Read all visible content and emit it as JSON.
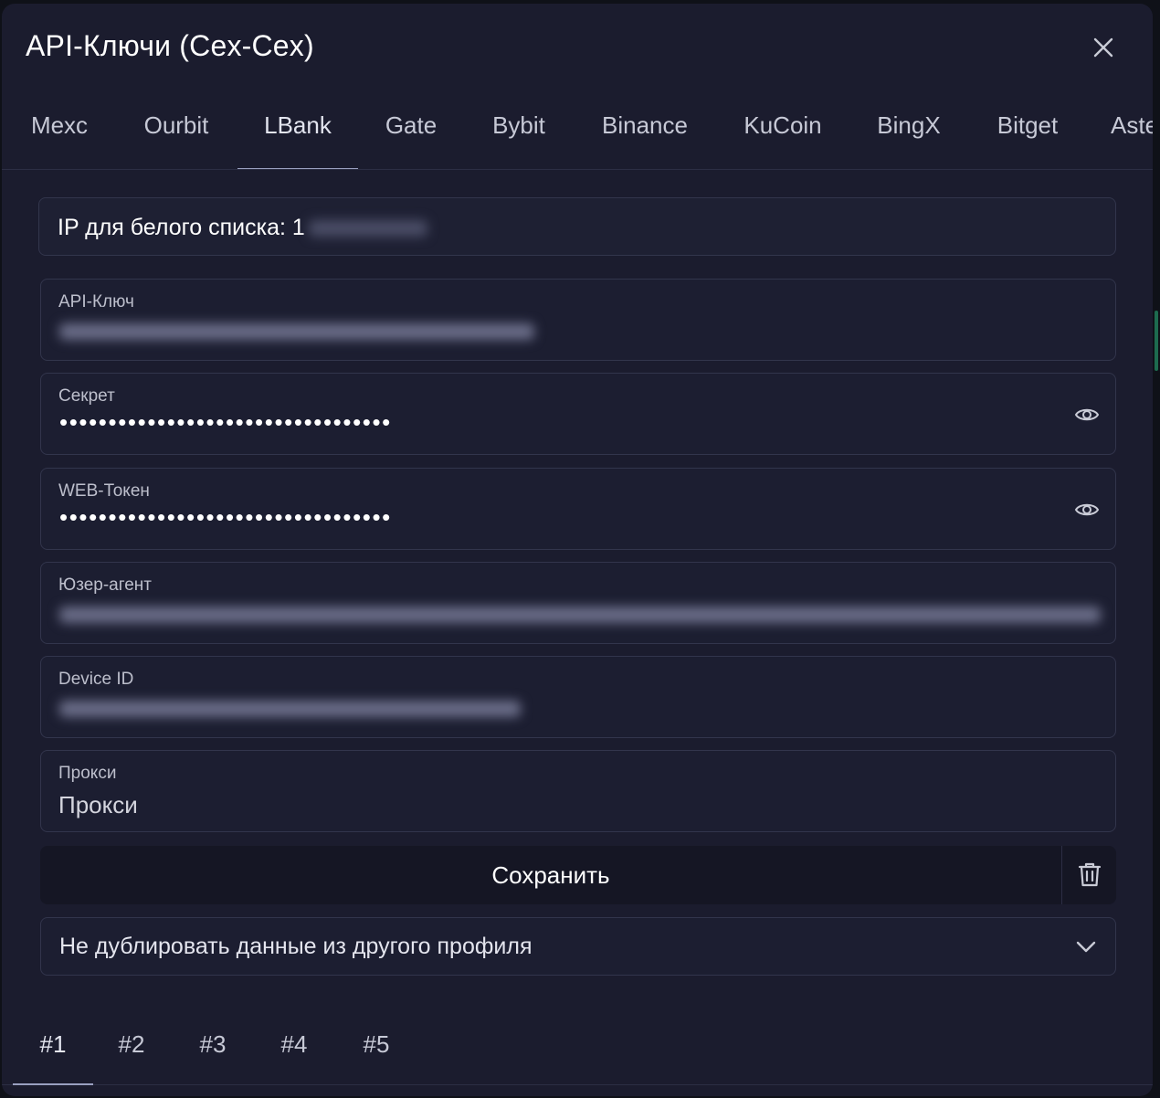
{
  "dialog": {
    "title": "API-Ключи (Cex-Cex)"
  },
  "exchange_tabs": [
    {
      "label": "Mexc"
    },
    {
      "label": "Ourbit"
    },
    {
      "label": "LBank"
    },
    {
      "label": "Gate"
    },
    {
      "label": "Bybit"
    },
    {
      "label": "Binance"
    },
    {
      "label": "KuCoin"
    },
    {
      "label": "BingX"
    },
    {
      "label": "Bitget"
    },
    {
      "label": "Aste"
    }
  ],
  "active_exchange_tab": "LBank",
  "ip_whitelist": {
    "label": "IP для белого списка: 1"
  },
  "fields": {
    "api_key": {
      "label": "API-Ключ",
      "value_blurred": true
    },
    "secret": {
      "label": "Секрет",
      "value": "••••••••••••••••••••••••••••••••••"
    },
    "web_token": {
      "label": "WEB-Токен",
      "value": "••••••••••••••••••••••••••••••••••"
    },
    "user_agent": {
      "label": "Юзер-агент",
      "value_blurred": true
    },
    "device_id": {
      "label": "Device ID",
      "value_blurred": true
    },
    "proxy": {
      "label": "Прокси",
      "placeholder": "Прокси"
    }
  },
  "actions": {
    "save_label": "Сохранить"
  },
  "duplicate_select": {
    "value": "Не дублировать данные из другого профиля"
  },
  "profile_tabs": [
    {
      "label": "#1"
    },
    {
      "label": "#2"
    },
    {
      "label": "#3"
    },
    {
      "label": "#4"
    },
    {
      "label": "#5"
    }
  ],
  "active_profile_tab": "#1",
  "icons": {
    "close": "close-icon",
    "reveal": "eye-icon",
    "delete": "trash-icon",
    "dropdown": "chevron-down-icon"
  },
  "colors": {
    "background": "#1b1c2e",
    "border": "#32354c",
    "text": "#ffffff",
    "muted_text": "#c7c9d6"
  }
}
